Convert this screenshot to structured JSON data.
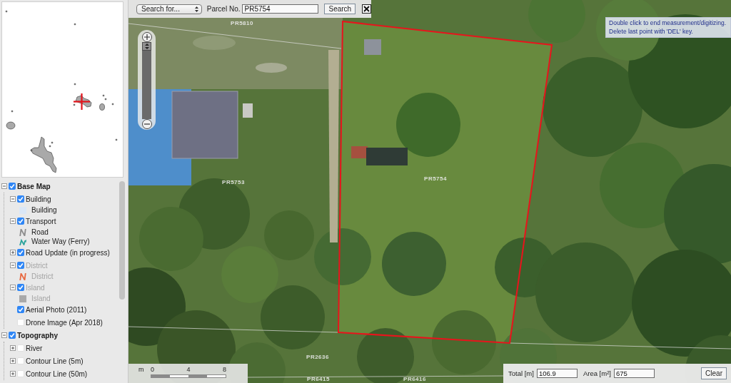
{
  "toolbar": {
    "search_type": "Search for...",
    "parcel_label": "Parcel No.",
    "parcel_value": "PR5754",
    "search_button": "Search"
  },
  "layers": [
    {
      "label": "Base Map",
      "checked": true,
      "expanded": true,
      "disabled": false,
      "children": [
        {
          "label": "Building",
          "checked": true,
          "expanded": true,
          "disabled": false,
          "legend": [
            {
              "kind": "area",
              "label": "Building",
              "color": "#dbe7f6"
            }
          ]
        },
        {
          "label": "Transport",
          "checked": true,
          "expanded": true,
          "disabled": false,
          "legend": [
            {
              "kind": "line",
              "label": "Road",
              "color": "#8c8c8c"
            },
            {
              "kind": "ferry",
              "label": "Water Way (Ferry)",
              "color": "#2aa39b"
            }
          ]
        },
        {
          "label": "Road Update (in progress)",
          "checked": true,
          "expanded": false,
          "disabled": false
        },
        {
          "label": "District",
          "checked": true,
          "expanded": true,
          "disabled": true,
          "legend": [
            {
              "kind": "line",
              "label": "District",
              "color": "#e8683f"
            }
          ]
        },
        {
          "label": "Island",
          "checked": true,
          "expanded": true,
          "disabled": true,
          "legend": [
            {
              "kind": "area",
              "label": "Island",
              "color": "#a9a9a9"
            }
          ]
        },
        {
          "label": "Aerial Photo (2011)",
          "checked": true,
          "disabled": false
        },
        {
          "label": "Drone Image (Apr 2018)",
          "checked": false,
          "disabled": false
        }
      ]
    },
    {
      "label": "Topography",
      "checked": true,
      "expanded": true,
      "disabled": false,
      "children": [
        {
          "label": "River",
          "checked": false,
          "expanded": false,
          "disabled": false
        },
        {
          "label": "Contour Line (5m)",
          "checked": false,
          "expanded": false,
          "disabled": false
        },
        {
          "label": "Contour Line (50m)",
          "checked": false,
          "expanded": false,
          "disabled": false
        }
      ]
    }
  ],
  "map": {
    "parcel_labels": [
      "PR5810",
      "PR5753",
      "PR5754",
      "PR2636",
      "PR6415",
      "PR6416"
    ],
    "hint": [
      "Double click to end measurement/digitizing.",
      "Delete last point with 'DEL' key."
    ]
  },
  "zoom_slider": {
    "level": 1
  },
  "scale_bar": {
    "unit": "m",
    "ticks": [
      "0",
      "4",
      "8"
    ]
  },
  "measurement": {
    "total_label": "Total [m]",
    "total_value": "106.9",
    "area_label": "Area [m²]",
    "area_value": "675",
    "clear_button": "Clear"
  }
}
